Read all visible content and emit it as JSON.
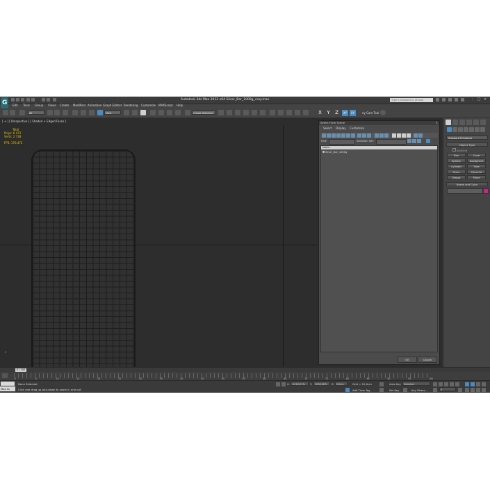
{
  "window": {
    "title": "Autodesk 3ds Max  2012 x64     Silver_Bar_1000g_vray.max",
    "search_placeholder": "Type a keyword or phrase"
  },
  "menu": [
    "Edit",
    "Tools",
    "Group",
    "Views",
    "Create",
    "Modifiers",
    "Animation",
    "Graph Editors",
    "Rendering",
    "Customize",
    "MAXScript",
    "Help"
  ],
  "toolbar": {
    "selection_filter": "All",
    "ref_coord": "View",
    "named_selection": "Create Selection",
    "axis": [
      "X",
      "Y",
      "Z",
      "XY",
      "XY"
    ],
    "ribbon_label": "ey Cam Tool"
  },
  "viewport": {
    "label": "[ + ] [ Perspective ] [ Shaded + Edged Faces ]",
    "stats": {
      "total_label": "Total",
      "polys_label": "Polys:",
      "polys_value": "6 472",
      "verts_label": "Verts:",
      "verts_value": "2 738",
      "fps_label": "FPS:",
      "fps_value": "176,472"
    }
  },
  "dialog": {
    "title": "Select From Scene",
    "tabs": [
      "Select",
      "Display",
      "Customize"
    ],
    "find_label": "Find:",
    "selection_set_label": "Selection Set:",
    "column_header": "Name",
    "items": [
      "Silver_Bar_1000g"
    ],
    "ok": "OK",
    "cancel": "Cancel"
  },
  "command_panel": {
    "category": "Standard Primitives",
    "object_type_header": "Object Type",
    "autogrid": "AutoGrid",
    "buttons": [
      "Box",
      "Cone",
      "Sphere",
      "GeoSphere",
      "Cylinder",
      "Tube",
      "Torus",
      "Pyramid",
      "Teapot",
      "Plane"
    ],
    "name_color_header": "Name and Color"
  },
  "timeline": {
    "slider": "0 / 100",
    "ticks": [
      "0",
      "5",
      "10",
      "15",
      "20",
      "25",
      "30",
      "35",
      "40",
      "45",
      "50",
      "55",
      "60",
      "65",
      "70",
      "75",
      "80",
      "85",
      "90",
      "95",
      "100"
    ]
  },
  "status": {
    "maxscript_btn": "Max to",
    "selection": "None Selected",
    "prompt": "Click and drag up-and-down to zoom in and out",
    "x_label": "X:",
    "x_value": "-1216,917c",
    "y_label": "Y:",
    "y_value": "1036,567c",
    "z_label": "Z:",
    "z_value": "0,0cm",
    "grid": "Grid = 10,0cm",
    "auto_key": "Auto Key",
    "set_key": "Set Key",
    "selected": "Selected",
    "key_filters": "Key Filters...",
    "add_time_tag": "Add Time Tag",
    "frame": "0"
  },
  "colors": {
    "accent": "#4a8bc2",
    "viewport_bg": "#2d2d2d",
    "ui_bg": "#444444",
    "stats": "#e6c800",
    "swatch": "#d0208a"
  }
}
